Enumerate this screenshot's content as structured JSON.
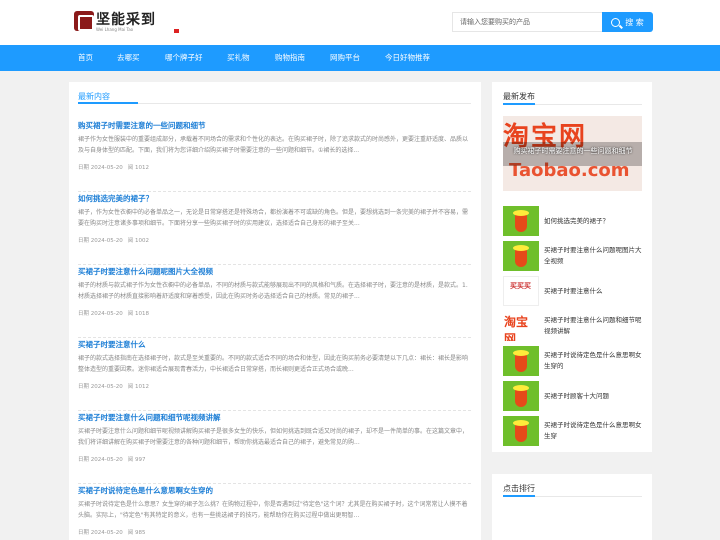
{
  "header": {
    "logo_text": "坚能采到",
    "logo_sub": "Wei Lhang Mai Tao",
    "search_placeholder": "请输入您要购买的产品",
    "search_button": "搜 索"
  },
  "nav": {
    "items": [
      "首页",
      "去哪买",
      "哪个牌子好",
      "买礼物",
      "购物指南",
      "网购平台",
      "今日好物推荐"
    ]
  },
  "main": {
    "section_title": "最新内容",
    "articles": [
      {
        "title": "购买裙子时需要注意的一些问题和细节",
        "desc": "裙子作为女性服装中的重要组成部分，承载着不同场合的需求和个性化的表达。在购买裙子时，除了追求款式的时尚感外，更要注重舒适度、品质以及与自身体型的匹配。下面，我们将为您详细介绍购买裙子时需要注意的一些问题和细节。①裙长的选择...",
        "date": "日期 2024-05-20",
        "views": "阅 1012"
      },
      {
        "title": "如何挑选完美的裙子？",
        "desc": "裙子，作为女性衣橱中的必备单品之一，无论是日常穿搭还是特殊场合，都扮演着不可或缺的角色。但是，要想挑选到一条完美的裙子并不容易，需要在购买时注意诸多事项和细节。下面将分享一些购买裙子时的实用建议，选择适合自己身形的裙子至关...",
        "date": "日期 2024-05-20",
        "views": "阅 1002"
      },
      {
        "title": "买裙子时要注意什么问题呢图片大全视频",
        "desc": "裙子的材质与款式裙子作为女性衣橱中的必备单品，不同的材质与款式能够展现出不同的风格和气质。在选择裙子时，要注意的是材质，是款式。1.材质选择裙子的材质直接影响着舒适度和穿着感受，因此在购买时务必选择适合自己的材质。常见的裙子...",
        "date": "日期 2024-05-20",
        "views": "阅 1018"
      },
      {
        "title": "买裙子时要注意什么",
        "desc": "裙子的款式选择指南在选择裙子时，款式是至关重要的。不同的款式适合不同的场合和体型，因此在购买前务必要清楚以下几点：裙长：裙长是影响整体造型的重要因素。迷你裙适合展现青春活力，中长裙适合日常穿搭，而长裙则更适合正式场合或晚...",
        "date": "日期 2024-05-20",
        "views": "阅 1012"
      },
      {
        "title": "买裙子时要注意什么问题和细节呢视频讲解",
        "desc": "买裙子时要注意什么问题和细节呢视频讲解购买裙子是很多女生的快乐，但如何挑选到既合适又时尚的裙子，却不是一件简单的事。在这篇文章中，我们将详细讲解在购买裙子时需要注意的各种问题和细节，帮助你挑选最适合自己的裙子，避免常见的购...",
        "date": "日期 2024-05-20",
        "views": "阅 997"
      },
      {
        "title": "买裙子时说待定色是什么意思啊女生穿的",
        "desc": "买裙子时说待定色是什么意思？女生穿的裙子怎么挑？在购物过程中，你是否遇到过\"待定色\"这个词？尤其是在购买裙子时，这个词常常让人摸不着头脑。实际上，\"待定色\"有其特定的意义，也有一些挑选裙子的技巧，能帮助你在购买过程中做出更明智...",
        "date": "日期 2024-05-20",
        "views": "阅 985"
      }
    ]
  },
  "sidebar": {
    "latest_title": "最新发布",
    "featured": {
      "image_text": "淘宝网",
      "image_sub": "Taobao.com",
      "caption": "购买裙子时需要注意的一些问题和细节"
    },
    "items": [
      {
        "text": "如何挑选完美的裙子？",
        "thumb": "green"
      },
      {
        "text": "买裙子时要注意什么问题呢图片大全视频",
        "thumb": "green"
      },
      {
        "text": "买裙子时要注意什么",
        "thumb": "white",
        "thumb_text": "买买买"
      },
      {
        "text": "买裙子时要注意什么问题和细节呢视频讲解",
        "thumb": "taobao",
        "thumb_text": "淘宝网"
      },
      {
        "text": "买裙子时说待定色是什么意思啊女生穿的",
        "thumb": "green"
      },
      {
        "text": "买裙子时顾客十大问题",
        "thumb": "green"
      },
      {
        "text": "买裙子时说待定色是什么意思啊女生穿",
        "thumb": "green"
      }
    ],
    "ranking_title": "点击排行"
  },
  "colors": {
    "accent": "#1e9bff",
    "link": "#1e7fd6",
    "taobao_orange": "#e8431e"
  }
}
